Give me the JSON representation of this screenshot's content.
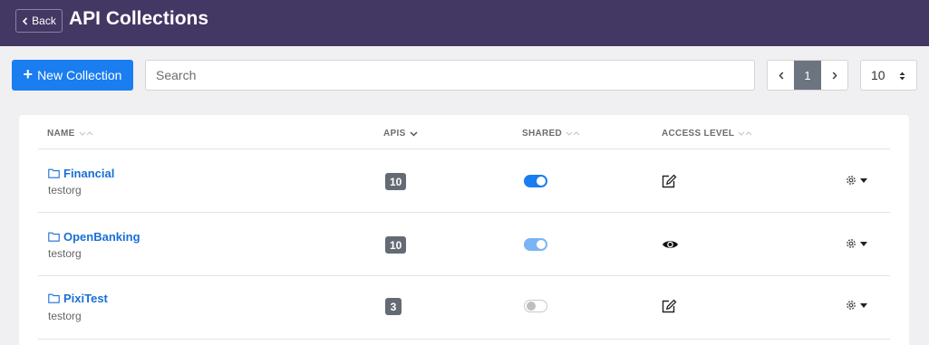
{
  "header": {
    "back_label": "Back",
    "title": "API Collections"
  },
  "toolbar": {
    "new_collection_label": "New Collection",
    "search_placeholder": "Search",
    "current_page": "1",
    "page_size": "10"
  },
  "table": {
    "columns": [
      "NAME",
      "APIS",
      "SHARED",
      "ACCESS LEVEL"
    ],
    "rows": [
      {
        "name": "Financial",
        "org": "testorg",
        "apis": "10",
        "shared": "on",
        "access": "edit-icon"
      },
      {
        "name": "OpenBanking",
        "org": "testorg",
        "apis": "10",
        "shared": "on-disabled",
        "access": "eye-icon"
      },
      {
        "name": "PixiTest",
        "org": "testorg",
        "apis": "3",
        "shared": "off",
        "access": "edit-icon"
      }
    ]
  },
  "colors": {
    "header_bg": "#433763",
    "primary": "#1a7df0",
    "link": "#1a6fd6",
    "badge": "#646b74"
  }
}
